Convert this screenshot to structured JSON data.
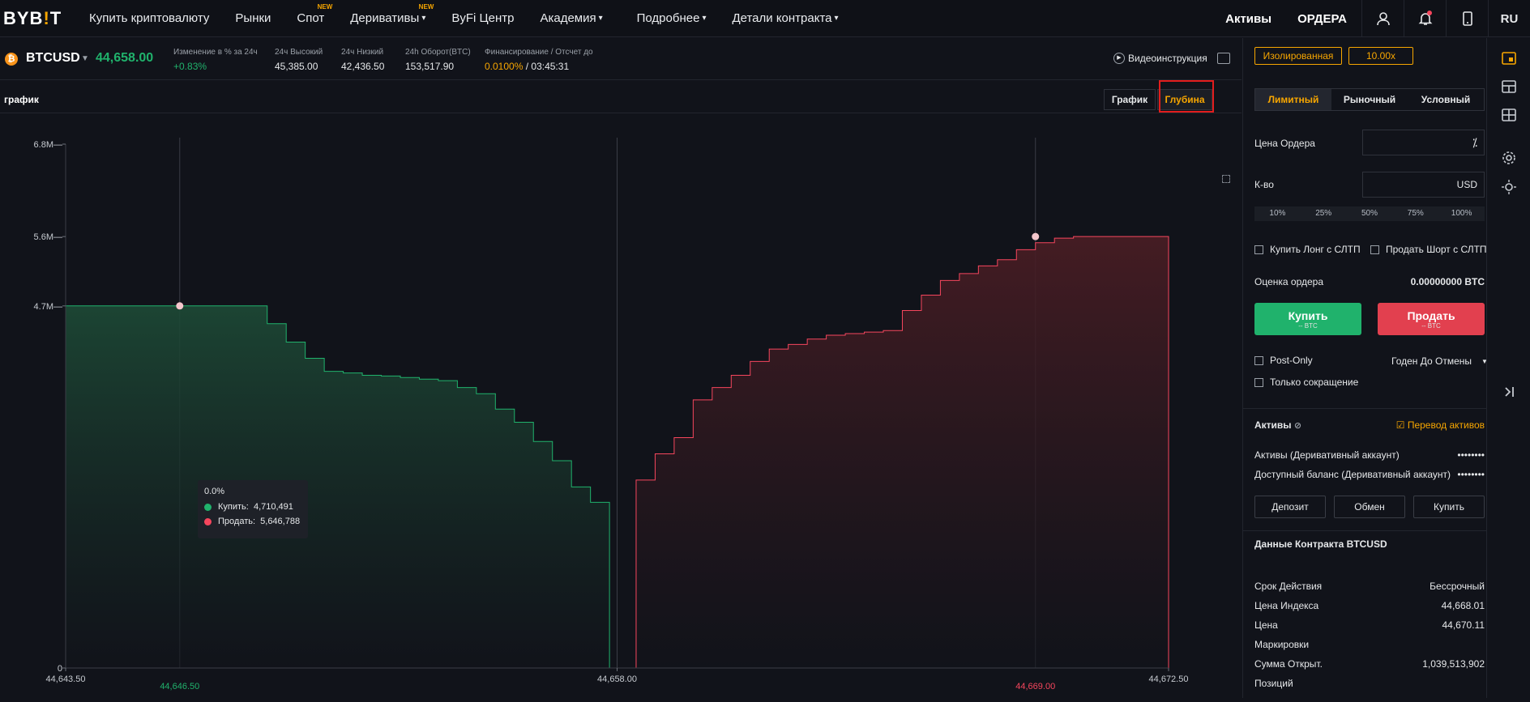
{
  "nav": {
    "logo_a": "BYB",
    "logo_b": "!",
    "logo_c": "T",
    "items": [
      {
        "label": "Купить криптовалюту"
      },
      {
        "label": "Рынки"
      },
      {
        "label": "Спот",
        "badge": "NEW"
      },
      {
        "label": "Деривативы",
        "badge": "NEW",
        "caret": "▾"
      },
      {
        "label": "ByFi Центр"
      },
      {
        "label": "Академия",
        "caret": "▾"
      },
      {
        "label": "Подробнее",
        "caret": "▾"
      },
      {
        "label": "Детали контракта",
        "caret": "▾"
      }
    ],
    "assets": "Активы",
    "orders": "ОРДЕРА",
    "lang": "RU"
  },
  "ticker": {
    "coin_glyph": "₿",
    "symbol": "BTCUSD",
    "last_price": "44,658.00",
    "change_label": "Изменение в % за 24ч",
    "change_value": "+0.83%",
    "high_label": "24ч Высокий",
    "high_value": "45,385.00",
    "low_label": "24ч Низкий",
    "low_value": "42,436.50",
    "turnover_label": "24h Оборот(BTC)",
    "turnover_value": "153,517.90",
    "funding_label": "Финансирование / Отсчет до",
    "funding_rate": "0.0100%",
    "funding_sep": "/",
    "funding_time": "03:45:31",
    "video_icon": "▶",
    "video_label": "Видеоинструкция"
  },
  "chart_header": {
    "title": "график",
    "tab_chart": "График",
    "tab_depth": "Глубина"
  },
  "chart_data": {
    "type": "area",
    "y_ticks": [
      "6.8M",
      "5.6M",
      "4.7M",
      "0"
    ],
    "y_tick_values": [
      6800000,
      5600000,
      4700000,
      0
    ],
    "x_ticks": [
      "44,643.50",
      "44,658.00",
      "44,672.50"
    ],
    "x_tick_values": [
      44643.5,
      44658.0,
      44672.5
    ],
    "xlim": [
      44643.5,
      44672.5
    ],
    "ylim": [
      0,
      6800000
    ],
    "series": [
      {
        "name": "Купить",
        "color": "#20b26c",
        "points": [
          [
            44643.5,
            4700000
          ],
          [
            44648.3,
            4700000
          ],
          [
            44648.8,
            4470000
          ],
          [
            44649.3,
            4230000
          ],
          [
            44649.8,
            4020000
          ],
          [
            44650.3,
            3850000
          ],
          [
            44650.8,
            3830000
          ],
          [
            44651.3,
            3800000
          ],
          [
            44651.8,
            3790000
          ],
          [
            44652.3,
            3770000
          ],
          [
            44652.8,
            3750000
          ],
          [
            44653.3,
            3730000
          ],
          [
            44653.8,
            3640000
          ],
          [
            44654.3,
            3560000
          ],
          [
            44654.8,
            3360000
          ],
          [
            44655.3,
            3190000
          ],
          [
            44655.8,
            2940000
          ],
          [
            44656.3,
            2690000
          ],
          [
            44656.8,
            2350000
          ],
          [
            44657.3,
            2150000
          ],
          [
            44657.8,
            0
          ]
        ]
      },
      {
        "name": "Продать",
        "color": "#f6465d",
        "points": [
          [
            44658.5,
            2440000
          ],
          [
            44659.0,
            2780000
          ],
          [
            44659.5,
            2990000
          ],
          [
            44660.0,
            3480000
          ],
          [
            44660.5,
            3640000
          ],
          [
            44661.0,
            3800000
          ],
          [
            44661.5,
            3980000
          ],
          [
            44662.0,
            4140000
          ],
          [
            44662.5,
            4200000
          ],
          [
            44663.0,
            4270000
          ],
          [
            44663.5,
            4320000
          ],
          [
            44664.0,
            4340000
          ],
          [
            44664.5,
            4360000
          ],
          [
            44665.0,
            4380000
          ],
          [
            44665.5,
            4640000
          ],
          [
            44666.0,
            4840000
          ],
          [
            44666.5,
            5030000
          ],
          [
            44667.0,
            5120000
          ],
          [
            44667.5,
            5220000
          ],
          [
            44668.0,
            5300000
          ],
          [
            44668.5,
            5430000
          ],
          [
            44669.0,
            5520000
          ],
          [
            44669.5,
            5580000
          ],
          [
            44670.0,
            5600000
          ],
          [
            44672.5,
            5600000
          ]
        ]
      }
    ],
    "crosshair_buy_price": "44,646.50",
    "crosshair_buy_value": 44646.5,
    "crosshair_sell_price": "44,669.00",
    "crosshair_sell_value": 44669.0,
    "center_value": 44658.0,
    "tooltip": {
      "title": "0.0%",
      "buy_label": "Купить",
      "buy_value": "4,710,491",
      "sell_label": "Продать",
      "sell_value": "5,646,788"
    }
  },
  "order": {
    "margin_mode": "Изолированная",
    "leverage": "10.00x",
    "tabs": [
      "Лимитный",
      "Рыночный",
      "Условный"
    ],
    "price_label": "Цена Ордера",
    "qty_label": "К-во",
    "qty_unit": "USD",
    "percents": [
      "10%",
      "25%",
      "50%",
      "75%",
      "100%"
    ],
    "tp_buy": "Купить Лонг с СЛТП",
    "tp_sell": "Продать Шорт с СЛТП",
    "estimate_label": "Оценка ордера",
    "estimate_value": "0.00000000 BTC",
    "buy_label": "Купить",
    "buy_sub": "-- BTC",
    "sell_label": "Продать",
    "sell_sub": "-- BTC",
    "post_only": "Post-Only",
    "tif": "Годен До Отмены",
    "reduce_only": "Только сокращение"
  },
  "assets_panel": {
    "title": "Активы",
    "transfer": "Перевод активов",
    "assets_label": "Активы (Деривативный аккаунт)",
    "assets_value": "••••••••",
    "available_label": "Доступный баланс (Деривативный аккаунт)",
    "available_value": "••••••••",
    "deposit": "Депозит",
    "exchange": "Обмен",
    "buy": "Купить"
  },
  "contract": {
    "title": "Данные Контракта BTCUSD",
    "rows": [
      {
        "label": "Срок Действия",
        "value": "Бессрочный"
      },
      {
        "label": "Цена Индекса",
        "value": "44,668.01"
      },
      {
        "label": "Цена",
        "value": "44,670.11"
      },
      {
        "label": "Маркировки",
        "value": ""
      },
      {
        "label": "Сумма Открыт.",
        "value": "1,039,513,902"
      },
      {
        "label": "Позиций",
        "value": ""
      }
    ]
  },
  "colors": {
    "accent": "#f7a600",
    "buy": "#20b26c",
    "sell": "#f6465d",
    "bg": "#11131a"
  }
}
